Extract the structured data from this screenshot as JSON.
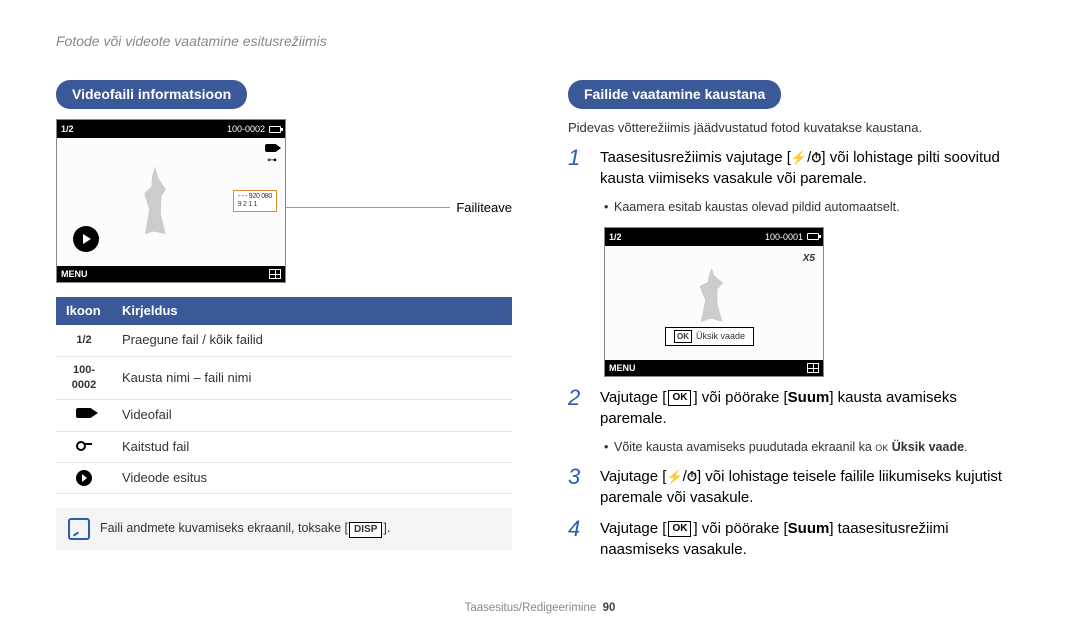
{
  "page_header": "Fotode või videote vaatamine esitusrežiimis",
  "left": {
    "heading_pill": "Videofaili informatsioon",
    "cam": {
      "counter": "1/2",
      "folder": "100-0002",
      "overlay_box_line1": "- - -    920  080",
      "overlay_box_line2": "9  2  1   1",
      "menu_label": "MENU"
    },
    "fileinfo_label": "Failiteave",
    "table": {
      "head_icon": "Ikoon",
      "head_desc": "Kirjeldus",
      "rows": [
        {
          "icon_text": "1/2",
          "desc": "Praegune fail / kõik failid"
        },
        {
          "icon_text": "100-0002",
          "desc": "Kausta nimi – faili nimi"
        },
        {
          "icon_text": "",
          "desc": "Videofail"
        },
        {
          "icon_text": "",
          "desc": "Kaitstud fail"
        },
        {
          "icon_text": "",
          "desc": "Videode esitus"
        }
      ]
    },
    "note": {
      "before": "Faili andmete kuvamiseks ekraanil, toksake [",
      "disp": "DISP",
      "after": "]."
    }
  },
  "right": {
    "heading_pill": "Failide vaatamine kaustana",
    "intro": "Pidevas võtterežiimis jäädvustatud fotod kuvatakse kaustana.",
    "step1": {
      "num": "1",
      "text_before": "Taasesitusrežiimis vajutage [",
      "flash": "⚡",
      "slash": "/",
      "timer": "⏱",
      "text_after": "] või lohistage pilti soovitud kausta viimiseks vasakule või paremale.",
      "bullet": "Kaamera esitab kaustas olevad pildid automaatselt."
    },
    "cam": {
      "counter": "1/2",
      "folder": "100-0001",
      "x5": "X5",
      "ok": "OK",
      "single_view": "Üksik vaade",
      "menu_label": "MENU"
    },
    "step2": {
      "num": "2",
      "before": "Vajutage [",
      "ok": "OK",
      "mid": "] või pöörake [",
      "suum": "Suum",
      "after": "] kausta avamiseks paremale.",
      "bullet_before": "Võite kausta avamiseks puudutada ekraanil ka ",
      "bullet_ok": "OK",
      "bullet_label": " Üksik vaade",
      "bullet_after": "."
    },
    "step3": {
      "num": "3",
      "before": "Vajutage [",
      "flash": "⚡",
      "slash": "/",
      "timer": "⏱",
      "after": "] või lohistage teisele failile liikumiseks kujutist paremale või vasakule."
    },
    "step4": {
      "num": "4",
      "before": "Vajutage [",
      "ok": "OK",
      "mid": "] või pöörake [",
      "suum": "Suum",
      "after": "] taasesitusrežiimi naasmiseks vasakule."
    }
  },
  "footer": {
    "section": "Taasesitus/Redigeerimine",
    "page": "90"
  }
}
